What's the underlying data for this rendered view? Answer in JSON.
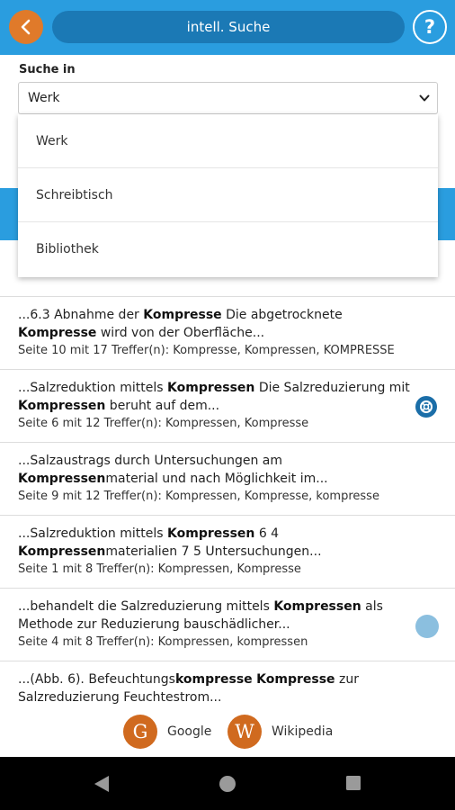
{
  "header": {
    "title": "intell. Suche",
    "help_label": "?",
    "colors": {
      "bar": "#2a9ddf",
      "pill": "#1b79b5",
      "back": "#e07a2a"
    },
    "back_icon": "chevron-left-icon"
  },
  "search": {
    "label": "Suche in",
    "selected": "Werk",
    "options": [
      "Werk",
      "Schreibtisch",
      "Bibliothek"
    ]
  },
  "results": [
    {
      "parts": [
        {
          "t": "...6.3 Abnahme der ",
          "b": false
        },
        {
          "t": "Kompresse",
          "b": true
        },
        {
          "t": " Die abgetrocknete ",
          "b": false
        },
        {
          "t": "Kompresse",
          "b": true
        },
        {
          "t": " wird von der Oberfläche...",
          "b": false
        }
      ],
      "page_info": "Seite 10 mit 17 Treffer(n): Kompresse, Kompressen, KOMPRESSE",
      "icon": null
    },
    {
      "parts": [
        {
          "t": "...Salzreduktion mittels ",
          "b": false
        },
        {
          "t": "Kompressen",
          "b": true
        },
        {
          "t": " Die Salzreduzierung mit ",
          "b": false
        },
        {
          "t": "Kompressen",
          "b": true
        },
        {
          "t": " beruht auf dem...",
          "b": false
        }
      ],
      "page_info": "Seite 6 mit 12 Treffer(n): Kompressen, Kompresse",
      "icon": "help-circle-icon"
    },
    {
      "parts": [
        {
          "t": "...Salzaustrags durch Untersuchungen am ",
          "b": false
        },
        {
          "t": "Kompressen",
          "b": true
        },
        {
          "t": "material und nach Möglichkeit im...",
          "b": false
        }
      ],
      "page_info": "Seite 9 mit 12 Treffer(n): Kompressen, Kompresse, kompresse",
      "icon": null
    },
    {
      "parts": [
        {
          "t": "...Salzreduktion mittels ",
          "b": false
        },
        {
          "t": "Kompressen",
          "b": true
        },
        {
          "t": " 6 4 ",
          "b": false
        },
        {
          "t": "Kompressen",
          "b": true
        },
        {
          "t": "materialien 7 5 Untersuchungen...",
          "b": false
        }
      ],
      "page_info": "Seite 1 mit 8 Treffer(n): Kompressen, Kompresse",
      "icon": null
    },
    {
      "parts": [
        {
          "t": "...behandelt die Salzreduzierung mittels ",
          "b": false
        },
        {
          "t": "Kompressen",
          "b": true
        },
        {
          "t": " als Methode zur Reduzierung bauschädlicher...",
          "b": false
        }
      ],
      "page_info": "Seite 4 mit 8 Treffer(n): Kompressen, kompressen",
      "icon": "faded-circle"
    },
    {
      "parts": [
        {
          "t": "...(Abb. 6). Befeuchtungs",
          "b": false
        },
        {
          "t": "kompresse",
          "b": true
        },
        {
          "t": " ",
          "b": false
        },
        {
          "t": "Kompresse",
          "b": true
        },
        {
          "t": " zur Salzreduzierung Feuchtestrom...",
          "b": false
        }
      ],
      "page_info": "",
      "icon": null
    }
  ],
  "links": {
    "google": {
      "letter": "G",
      "label": "Google"
    },
    "wikipedia": {
      "letter": "W",
      "label": "Wikipedia"
    }
  },
  "navbar": {
    "icons": [
      "back-triangle-icon",
      "home-circle-icon",
      "recents-square-icon"
    ]
  }
}
